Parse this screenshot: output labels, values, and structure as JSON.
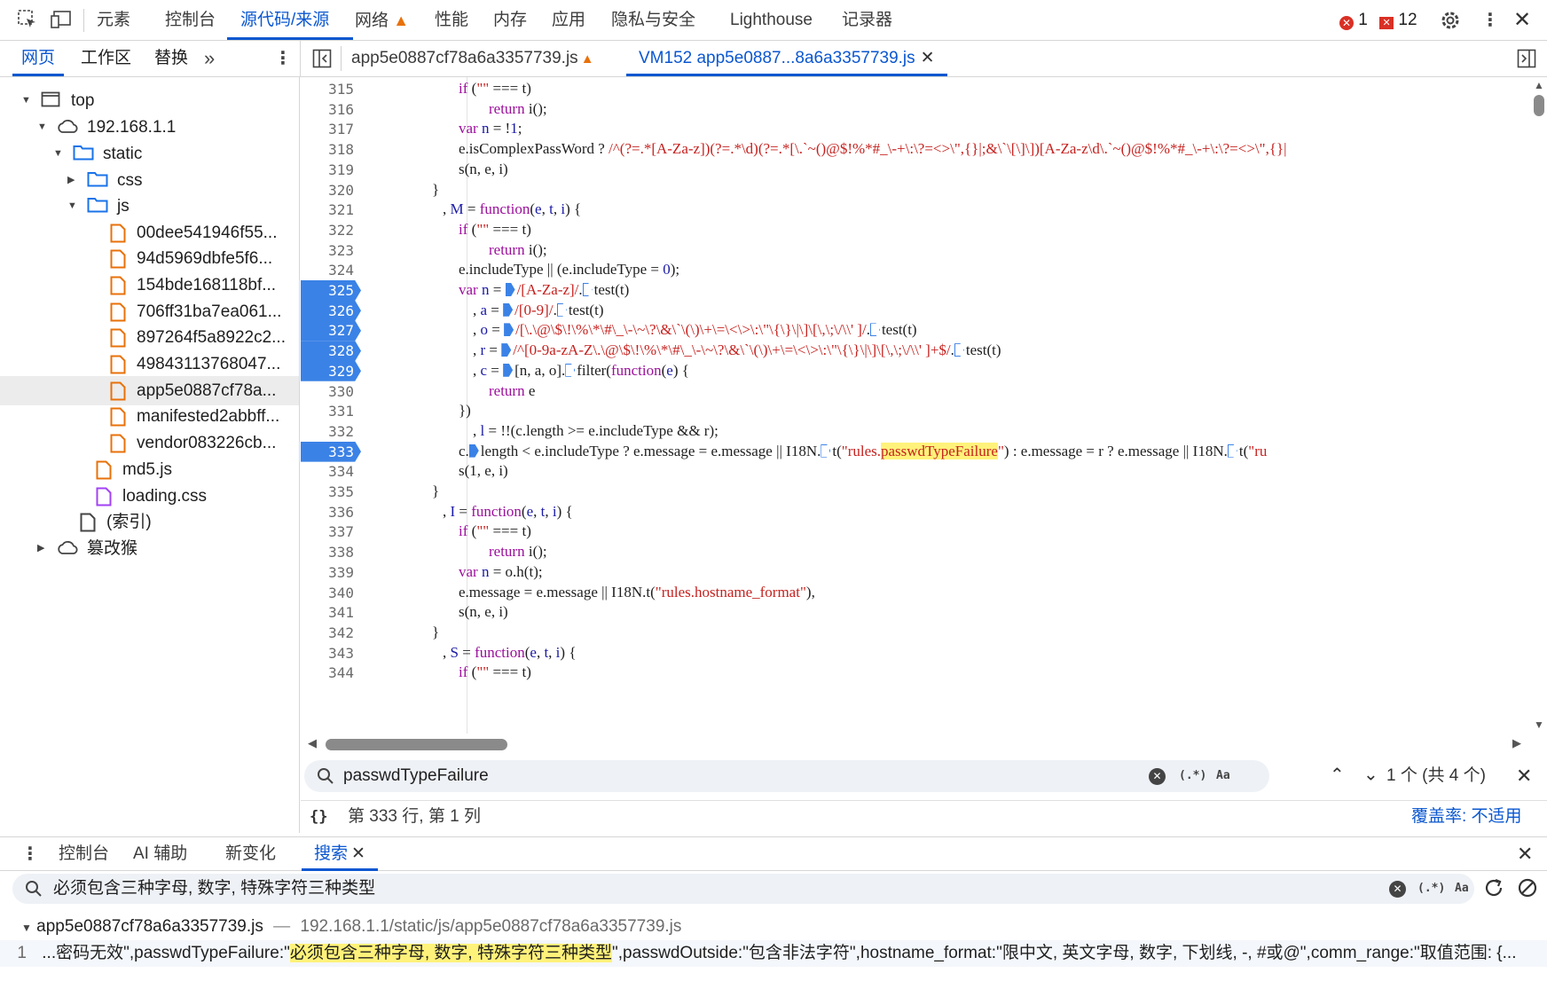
{
  "top_tabs": [
    {
      "label": "元素"
    },
    {
      "label": "控制台"
    },
    {
      "label": "源代码/来源"
    },
    {
      "label": "网络"
    },
    {
      "label": "性能"
    },
    {
      "label": "内存"
    },
    {
      "label": "应用"
    },
    {
      "label": "隐私与安全"
    },
    {
      "label": "Lighthouse"
    },
    {
      "label": "记录器"
    }
  ],
  "top_status": {
    "errors": "1",
    "warnings": "12"
  },
  "navigator_tabs": [
    {
      "label": "网页"
    },
    {
      "label": "工作区"
    },
    {
      "label": "替换"
    }
  ],
  "editor_tabs": [
    {
      "label": "app5e0887cf78a6a3357739.js"
    },
    {
      "label": "VM152 app5e0887...8a6a3357739.js"
    }
  ],
  "tree": [
    {
      "label": "top",
      "kind": "frame",
      "depth": 0,
      "expanded": true
    },
    {
      "label": "192.168.1.1",
      "kind": "cloud",
      "depth": 1,
      "expanded": true
    },
    {
      "label": "static",
      "kind": "folder",
      "depth": 2,
      "expanded": true
    },
    {
      "label": "css",
      "kind": "folder",
      "depth": 3,
      "expanded": false
    },
    {
      "label": "js",
      "kind": "folder",
      "depth": 3,
      "expanded": true
    },
    {
      "label": "00dee541946f55...",
      "kind": "js",
      "depth": 4
    },
    {
      "label": "94d5969dbfe5f6...",
      "kind": "js",
      "depth": 4
    },
    {
      "label": "154bde168118bf...",
      "kind": "js",
      "depth": 4
    },
    {
      "label": "706ff31ba7ea061...",
      "kind": "js",
      "depth": 4
    },
    {
      "label": "897264f5a8922c2...",
      "kind": "js",
      "depth": 4
    },
    {
      "label": "49843113768047...",
      "kind": "js",
      "depth": 4
    },
    {
      "label": "app5e0887cf78a...",
      "kind": "js",
      "depth": 4,
      "selected": true
    },
    {
      "label": "manifested2abbff...",
      "kind": "js",
      "depth": 4
    },
    {
      "label": "vendor083226cb...",
      "kind": "js",
      "depth": 4
    },
    {
      "label": "md5.js",
      "kind": "js",
      "depth": 3
    },
    {
      "label": "loading.css",
      "kind": "css",
      "depth": 3
    },
    {
      "label": "(索引)",
      "kind": "doc",
      "depth": 2
    },
    {
      "label": "篡改猴",
      "kind": "cloud",
      "depth": 1,
      "expanded": false
    }
  ],
  "code": {
    "line_numbers": [
      "315",
      "316",
      "317",
      "318",
      "319",
      "320",
      "321",
      "322",
      "323",
      "324",
      "325",
      "326",
      "327",
      "328",
      "329",
      "330",
      "331",
      "332",
      "333",
      "334",
      "335",
      "336",
      "337",
      "338",
      "339",
      "340",
      "341",
      "342",
      "343",
      "344"
    ],
    "breakpoint_lines": [
      "325",
      "326",
      "327",
      "328",
      "329",
      "333"
    ]
  },
  "find": {
    "query": "passwdTypeFailure",
    "regex_label": "(.*)",
    "case_label": "Aa",
    "count": "1 个 (共 4 个)"
  },
  "status": {
    "position": "第 333 行, 第 1 列",
    "coverage": "覆盖率: 不适用"
  },
  "drawer_tabs": [
    {
      "label": "控制台"
    },
    {
      "label": "AI 辅助"
    },
    {
      "label": "新变化"
    },
    {
      "label": "搜索"
    }
  ],
  "search": {
    "query": "必须包含三种字母, 数字, 特殊字符三种类型",
    "regex_label": "(.*)",
    "case_label": "Aa"
  },
  "results": {
    "file": "app5e0887cf78a6a3357739.js",
    "path": "192.168.1.1/static/js/app5e0887cf78a6a3357739.js",
    "line_no": "1",
    "pre": "...密码无效\",passwdTypeFailure:\"",
    "match": "必须包含三种字母, 数字, 特殊字符三种类型",
    "post": "\",passwdOutside:\"包含非法字符\",hostname_format:\"限中文, 英文字母, 数字, 下划线, -, #或@\",comm_range:\"取值范围: {..."
  }
}
